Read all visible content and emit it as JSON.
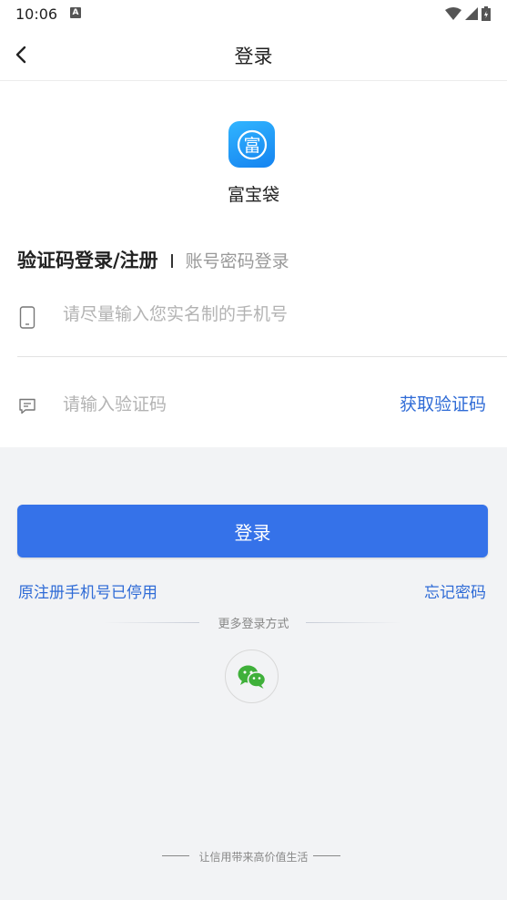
{
  "status_bar": {
    "time": "10:06",
    "notification_badge": "A",
    "icons": [
      "wifi-icon",
      "signal-icon",
      "battery-icon"
    ]
  },
  "header": {
    "title": "登录",
    "back_icon": "chevron-left-icon"
  },
  "app": {
    "name": "富宝袋",
    "logo_glyph": "富",
    "logo_colors": [
      "#31b5ff",
      "#1583f0"
    ]
  },
  "tabs": {
    "active": "验证码登录/注册",
    "inactive": "账号密码登录"
  },
  "phone_field": {
    "icon": "mobile-phone-icon",
    "value": "",
    "placeholder": "请尽量输入您实名制的手机号"
  },
  "code_field": {
    "icon": "message-icon",
    "value": "",
    "placeholder": "请输入验证码",
    "get_code_label": "获取验证码"
  },
  "login_button": {
    "label": "登录",
    "color": "#3572e9"
  },
  "links": {
    "phone_disabled": "原注册手机号已停用",
    "forgot_password": "忘记密码"
  },
  "more_login": {
    "label": "更多登录方式",
    "options": [
      "wechat-icon"
    ]
  },
  "footer": {
    "slogan": "让信用带来高价值生活"
  },
  "colors": {
    "accent": "#2f6bd6",
    "wechat_green": "#3fb03a"
  }
}
